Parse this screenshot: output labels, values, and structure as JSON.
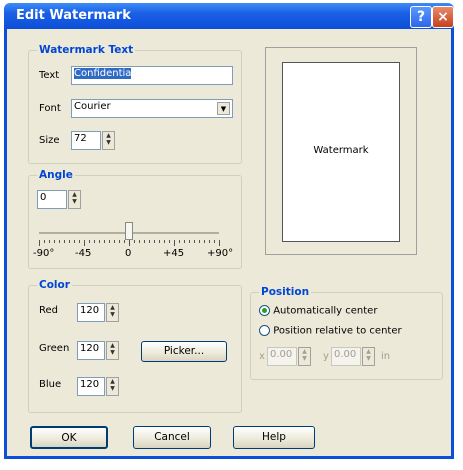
{
  "window": {
    "title": "Edit Watermark",
    "help_icon": "?",
    "close_icon": "×"
  },
  "watermark_text": {
    "legend": "Watermark Text",
    "text_label": "Text",
    "text_value": "Confidentia",
    "font_label": "Font",
    "font_value": "Courier",
    "size_label": "Size",
    "size_value": "72"
  },
  "preview": {
    "text": "Watermark"
  },
  "angle": {
    "legend": "Angle",
    "value": "0",
    "slider_fraction": 0.5,
    "tick_labels": [
      "-90°",
      "-45",
      "0",
      "+45",
      "+90°"
    ]
  },
  "color": {
    "legend": "Color",
    "red_label": "Red",
    "red_value": "120",
    "green_label": "Green",
    "green_value": "120",
    "blue_label": "Blue",
    "blue_value": "120",
    "picker_label": "Picker..."
  },
  "position": {
    "legend": "Position",
    "auto_label": "Automatically center",
    "relative_label": "Position relative to center",
    "x_label": "x",
    "x_value": "0.00",
    "y_label": "y",
    "y_value": "0.00",
    "unit": "in"
  },
  "buttons": {
    "ok": "OK",
    "cancel": "Cancel",
    "help": "Help"
  }
}
